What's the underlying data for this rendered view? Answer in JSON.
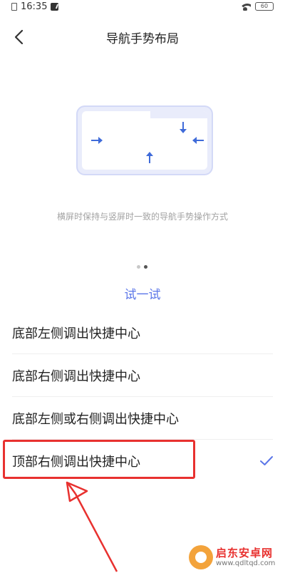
{
  "status_bar": {
    "time": "16:35",
    "battery": "60"
  },
  "header": {
    "title": "导航手势布局"
  },
  "description": "横屏时保持与竖屏时一致的导航手势操作方式",
  "try_link": "试一试",
  "options": [
    {
      "label": "底部左侧调出快捷中心",
      "selected": false
    },
    {
      "label": "底部右侧调出快捷中心",
      "selected": false
    },
    {
      "label": "底部左侧或右侧调出快捷中心",
      "selected": false
    },
    {
      "label": "顶部右侧调出快捷中心",
      "selected": true
    }
  ],
  "colors": {
    "accent": "#5b76e8",
    "annotation": "#e8312f",
    "illustration_bg": "#e9ecfb"
  },
  "watermark": {
    "brand": "启东安卓网",
    "url": "www.qdltqd.com"
  }
}
